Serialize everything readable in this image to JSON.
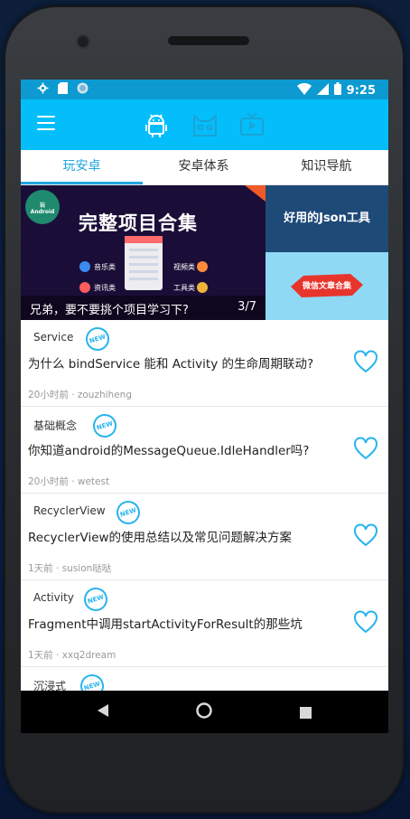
{
  "status_bar": {
    "time": "9:25",
    "left_icons": [
      "gear-icon",
      "sd-card-icon",
      "circle-icon"
    ],
    "right_icons": [
      "wifi-icon",
      "signal-icon",
      "battery-icon"
    ]
  },
  "toolbar": {
    "menu_icon": "hamburger-icon",
    "icons": [
      "android-icon",
      "cat-icon",
      "tv-icon"
    ],
    "colors": {
      "bar": "#03befb",
      "status": "#0c9ad1"
    }
  },
  "tabs": [
    {
      "label": "玩安卓"
    },
    {
      "label": "安卓体系"
    },
    {
      "label": "知识导航"
    }
  ],
  "banner": {
    "caption": "兄弟，要不要挑个项目学习下?",
    "index": "3/7",
    "main": {
      "title": "完整项目合集",
      "labels": [
        "音乐类",
        "视频类",
        "资讯类",
        "工具类"
      ],
      "logo_text": "玩Android"
    },
    "side_top_text": "好用的Json工具",
    "side_bottom_text": "微信文章合集"
  },
  "articles": [
    {
      "chapter": "Service",
      "badge": "NEW",
      "title": "为什么 bindService 能和 Activity 的生命周期联动?",
      "meta": "20小时前 · zouzhiheng"
    },
    {
      "chapter": "基础概念",
      "badge": "NEW",
      "title": "你知道android的MessageQueue.IdleHandler吗?",
      "meta": "20小时前 · wetest"
    },
    {
      "chapter": "RecyclerView",
      "badge": "NEW",
      "title": "RecyclerView的使用总结以及常见问题解决方案",
      "meta": "1天前 · susion哒哒"
    },
    {
      "chapter": "Activity",
      "badge": "NEW",
      "title": "Fragment中调用startActivityForResult的那些坑",
      "meta": "1天前 · xxq2dream"
    },
    {
      "chapter": "沉浸式",
      "badge": "NEW",
      "title": "",
      "meta": ""
    }
  ],
  "nav_bar": {
    "icons": [
      "back-icon",
      "home-icon",
      "recents-icon"
    ]
  }
}
